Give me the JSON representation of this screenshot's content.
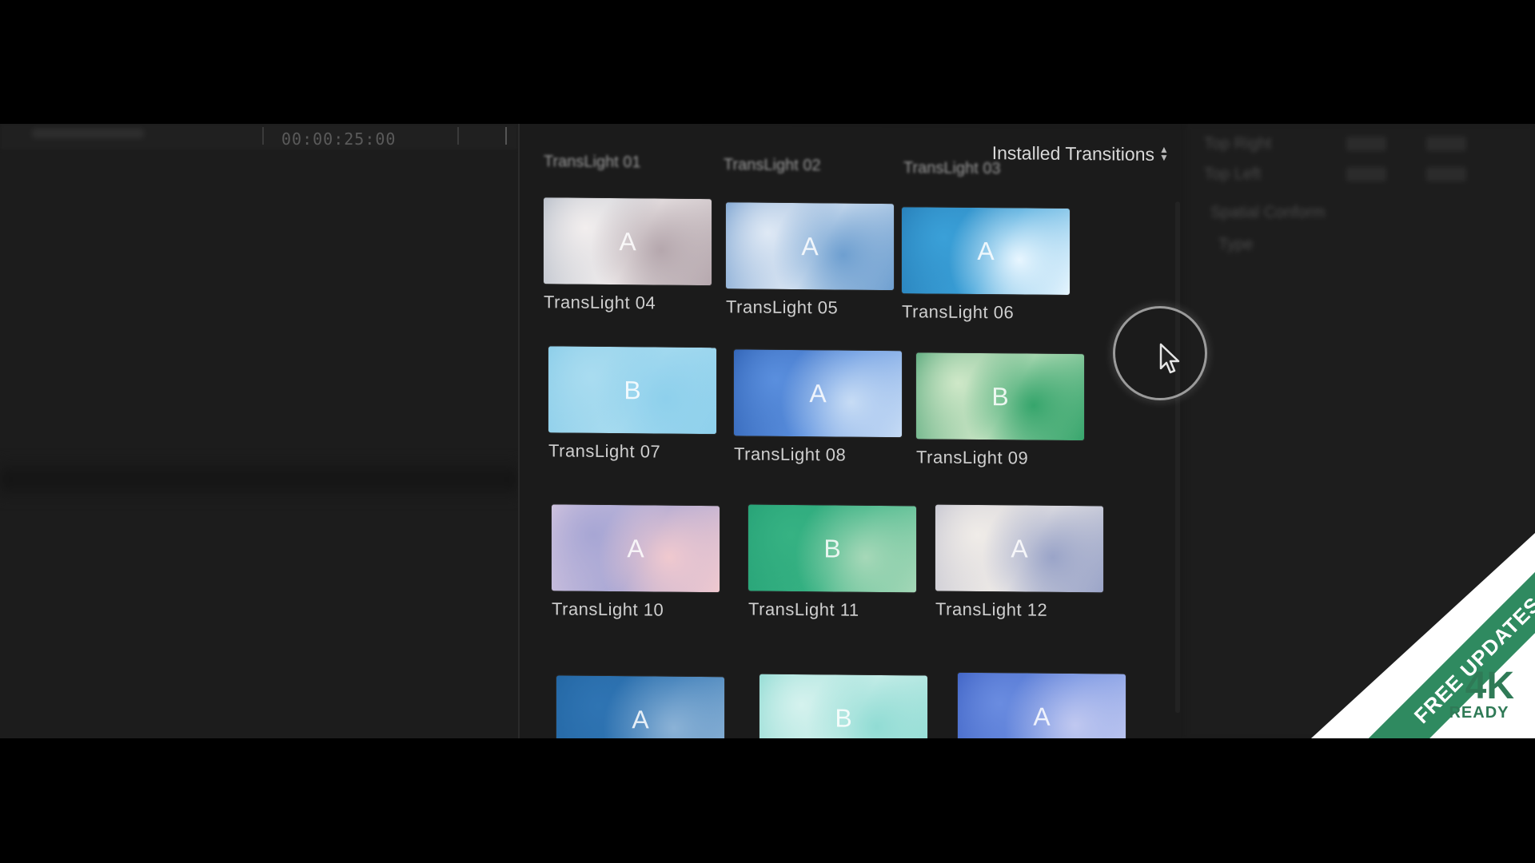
{
  "timeline": {
    "timecode": "00:00:25:00"
  },
  "browser": {
    "title": "Installed Transitions",
    "partial_row_labels": [
      "TransLight 01",
      "TransLight 02",
      "TransLight 03"
    ],
    "items": [
      {
        "label": "TransLight 04",
        "letter": "A",
        "colors": [
          "#9aa6b6",
          "#f2eeee",
          "#b5a7ad"
        ]
      },
      {
        "label": "TransLight 05",
        "letter": "A",
        "colors": [
          "#4d82bf",
          "#dfe9f5",
          "#6e9fd0"
        ]
      },
      {
        "label": "TransLight 06",
        "letter": "A",
        "colors": [
          "#1e6ea8",
          "#3aa0d8",
          "#e8f6ff"
        ]
      },
      {
        "label": "TransLight 07",
        "letter": "B",
        "colors": [
          "#7cc6e6",
          "#a9dcf0",
          "#8ed0ec"
        ]
      },
      {
        "label": "TransLight 08",
        "letter": "A",
        "colors": [
          "#1c4da1",
          "#5a8fde",
          "#c7dcf5"
        ]
      },
      {
        "label": "TransLight 09",
        "letter": "B",
        "colors": [
          "#1f8a57",
          "#cfe8c8",
          "#36a56c"
        ]
      },
      {
        "label": "TransLight 10",
        "letter": "A",
        "colors": [
          "#e6d3e4",
          "#a7a6d4",
          "#f0c9cf"
        ]
      },
      {
        "label": "TransLight 11",
        "letter": "B",
        "colors": [
          "#1f9a70",
          "#36b283",
          "#a6d8b8"
        ]
      },
      {
        "label": "TransLight 12",
        "letter": "A",
        "colors": [
          "#b2b4c6",
          "#f0ece8",
          "#9aa4c8"
        ]
      },
      {
        "label": "",
        "letter": "A",
        "colors": [
          "#1c5f9b",
          "#2f74b3",
          "#8bb2d6"
        ]
      },
      {
        "label": "",
        "letter": "B",
        "colors": [
          "#6fd0c6",
          "#d5f2ee",
          "#91dcd4"
        ]
      },
      {
        "label": "",
        "letter": "A",
        "colors": [
          "#2a4fb8",
          "#6a8ce0",
          "#c0c8f0"
        ]
      }
    ]
  },
  "badge": {
    "ribbon_text": "FREE UPDATES",
    "resolution": "4K",
    "ready_text": "READY",
    "ribbon_color": "#2f8a60"
  },
  "colors": {
    "background": "#1a1a1a",
    "panel": "#1b1b1b",
    "text": "#cfcfcf"
  }
}
